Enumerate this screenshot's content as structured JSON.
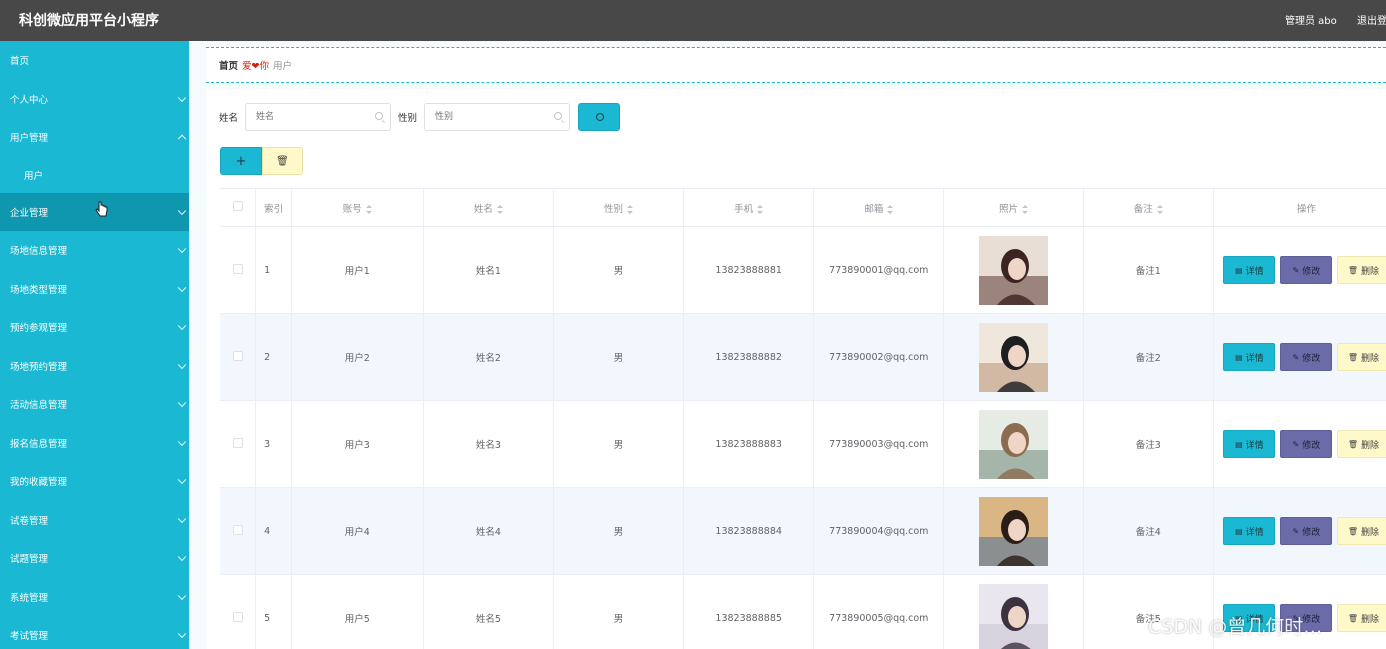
{
  "header": {
    "title": "科创微应用平台小程序",
    "admin": "管理员 abo",
    "logout": "退出登"
  },
  "sidebar": {
    "items": [
      {
        "label": "首页",
        "arrow": "none"
      },
      {
        "label": "个人中心",
        "arrow": "down"
      },
      {
        "label": "用户管理",
        "arrow": "up"
      },
      {
        "label": "用户",
        "arrow": "none",
        "sub": true
      },
      {
        "label": "企业管理",
        "arrow": "down",
        "active": true
      },
      {
        "label": "场地信息管理",
        "arrow": "down"
      },
      {
        "label": "场地类型管理",
        "arrow": "down"
      },
      {
        "label": "预约参观管理",
        "arrow": "down"
      },
      {
        "label": "场地预约管理",
        "arrow": "down"
      },
      {
        "label": "活动信息管理",
        "arrow": "down"
      },
      {
        "label": "报名信息管理",
        "arrow": "down"
      },
      {
        "label": "我的收藏管理",
        "arrow": "down"
      },
      {
        "label": "试卷管理",
        "arrow": "down"
      },
      {
        "label": "试题管理",
        "arrow": "down"
      },
      {
        "label": "系统管理",
        "arrow": "down"
      },
      {
        "label": "考试管理",
        "arrow": "down"
      }
    ]
  },
  "breadcrumb": {
    "home": "首页",
    "separator_left": "爱",
    "separator_right": "你",
    "current": "用户"
  },
  "search": {
    "name_label": "姓名",
    "name_placeholder": "姓名",
    "gender_label": "性别",
    "gender_placeholder": "性别"
  },
  "actions": {
    "add_label": "+",
    "delete_label": "🗑"
  },
  "table": {
    "headers": {
      "index": "索引",
      "account": "账号",
      "name": "姓名",
      "gender": "性别",
      "phone": "手机",
      "email": "邮箱",
      "photo": "照片",
      "remark": "备注",
      "ops": "操作"
    },
    "op_labels": {
      "detail": "详情",
      "edit": "修改",
      "delete": "删除"
    },
    "rows": [
      {
        "index": "1",
        "account": "用户1",
        "name": "姓名1",
        "gender": "男",
        "phone": "13823888881",
        "email": "773890001@qq.com",
        "remark": "备注1"
      },
      {
        "index": "2",
        "account": "用户2",
        "name": "姓名2",
        "gender": "男",
        "phone": "13823888882",
        "email": "773890002@qq.com",
        "remark": "备注2"
      },
      {
        "index": "3",
        "account": "用户3",
        "name": "姓名3",
        "gender": "男",
        "phone": "13823888883",
        "email": "773890003@qq.com",
        "remark": "备注3"
      },
      {
        "index": "4",
        "account": "用户4",
        "name": "姓名4",
        "gender": "男",
        "phone": "13823888884",
        "email": "773890004@qq.com",
        "remark": "备注4"
      },
      {
        "index": "5",
        "account": "用户5",
        "name": "姓名5",
        "gender": "男",
        "phone": "13823888885",
        "email": "773890005@qq.com",
        "remark": "备注5"
      }
    ]
  },
  "watermark": "CSDN @曾几何时…",
  "colors": {
    "accent": "#1ab8d2",
    "sidebar_active": "#0e97ae",
    "header": "#484848",
    "edit": "#6a6ba8",
    "delete": "#fff9c9"
  }
}
